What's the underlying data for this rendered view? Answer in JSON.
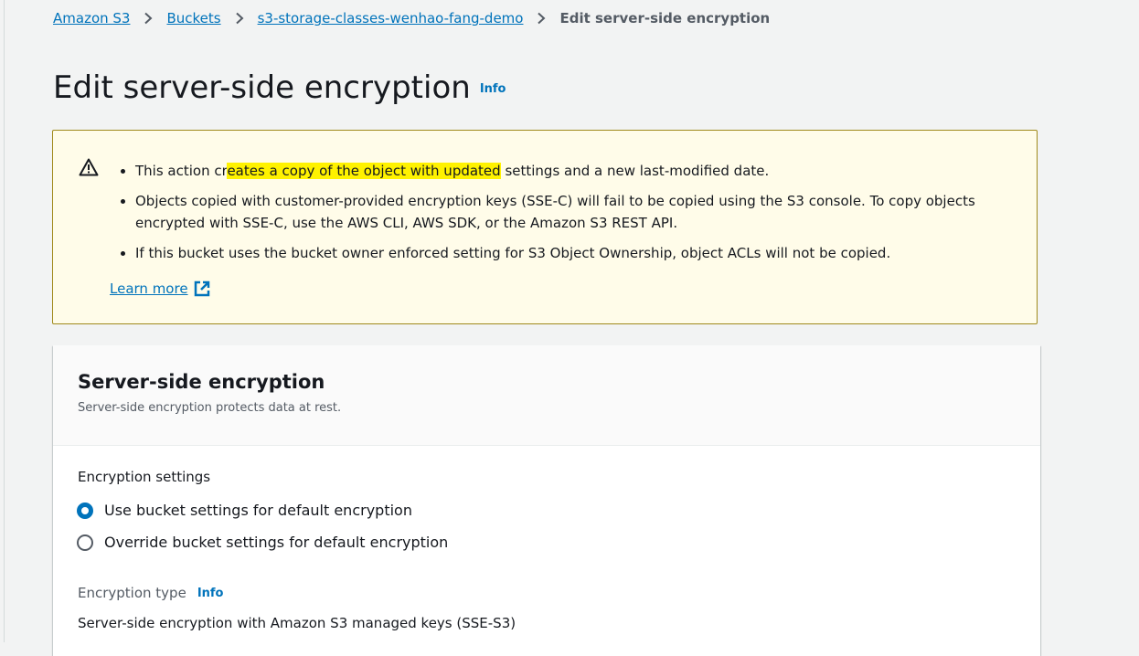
{
  "breadcrumb": {
    "items": [
      "Amazon S3",
      "Buckets",
      "s3-storage-classes-wenhao-fang-demo"
    ],
    "current": "Edit server-side encryption"
  },
  "page": {
    "title": "Edit server-side encryption",
    "info": "Info"
  },
  "alert": {
    "bullet1_pre": "This action cr",
    "bullet1_highlight": "eates a copy of the object with updated",
    "bullet1_post": " settings and a new last-modified date.",
    "bullet2": "Objects copied with customer-provided encryption keys (SSE-C) will fail to be copied using the S3 console. To copy objects encrypted with SSE-C, use the AWS CLI, AWS SDK, or the Amazon S3 REST API.",
    "bullet3": "If this bucket uses the bucket owner enforced setting for S3 Object Ownership, object ACLs will not be copied.",
    "learn_more": "Learn more",
    "icon": "warning-icon",
    "highlight_color": "#fff200"
  },
  "panel": {
    "title": "Server-side encryption",
    "description": "Server-side encryption protects data at rest.",
    "settings_label": "Encryption settings",
    "options": [
      {
        "label": "Use bucket settings for default encryption",
        "selected": true
      },
      {
        "label": "Override bucket settings for default encryption",
        "selected": false
      }
    ],
    "type_label": "Encryption type",
    "type_info": "Info",
    "type_value": "Server-side encryption with Amazon S3 managed keys (SSE-S3)"
  },
  "colors": {
    "accent": "#0073bb",
    "warning_border": "#a08a1b",
    "warning_bg": "#fffce9"
  }
}
